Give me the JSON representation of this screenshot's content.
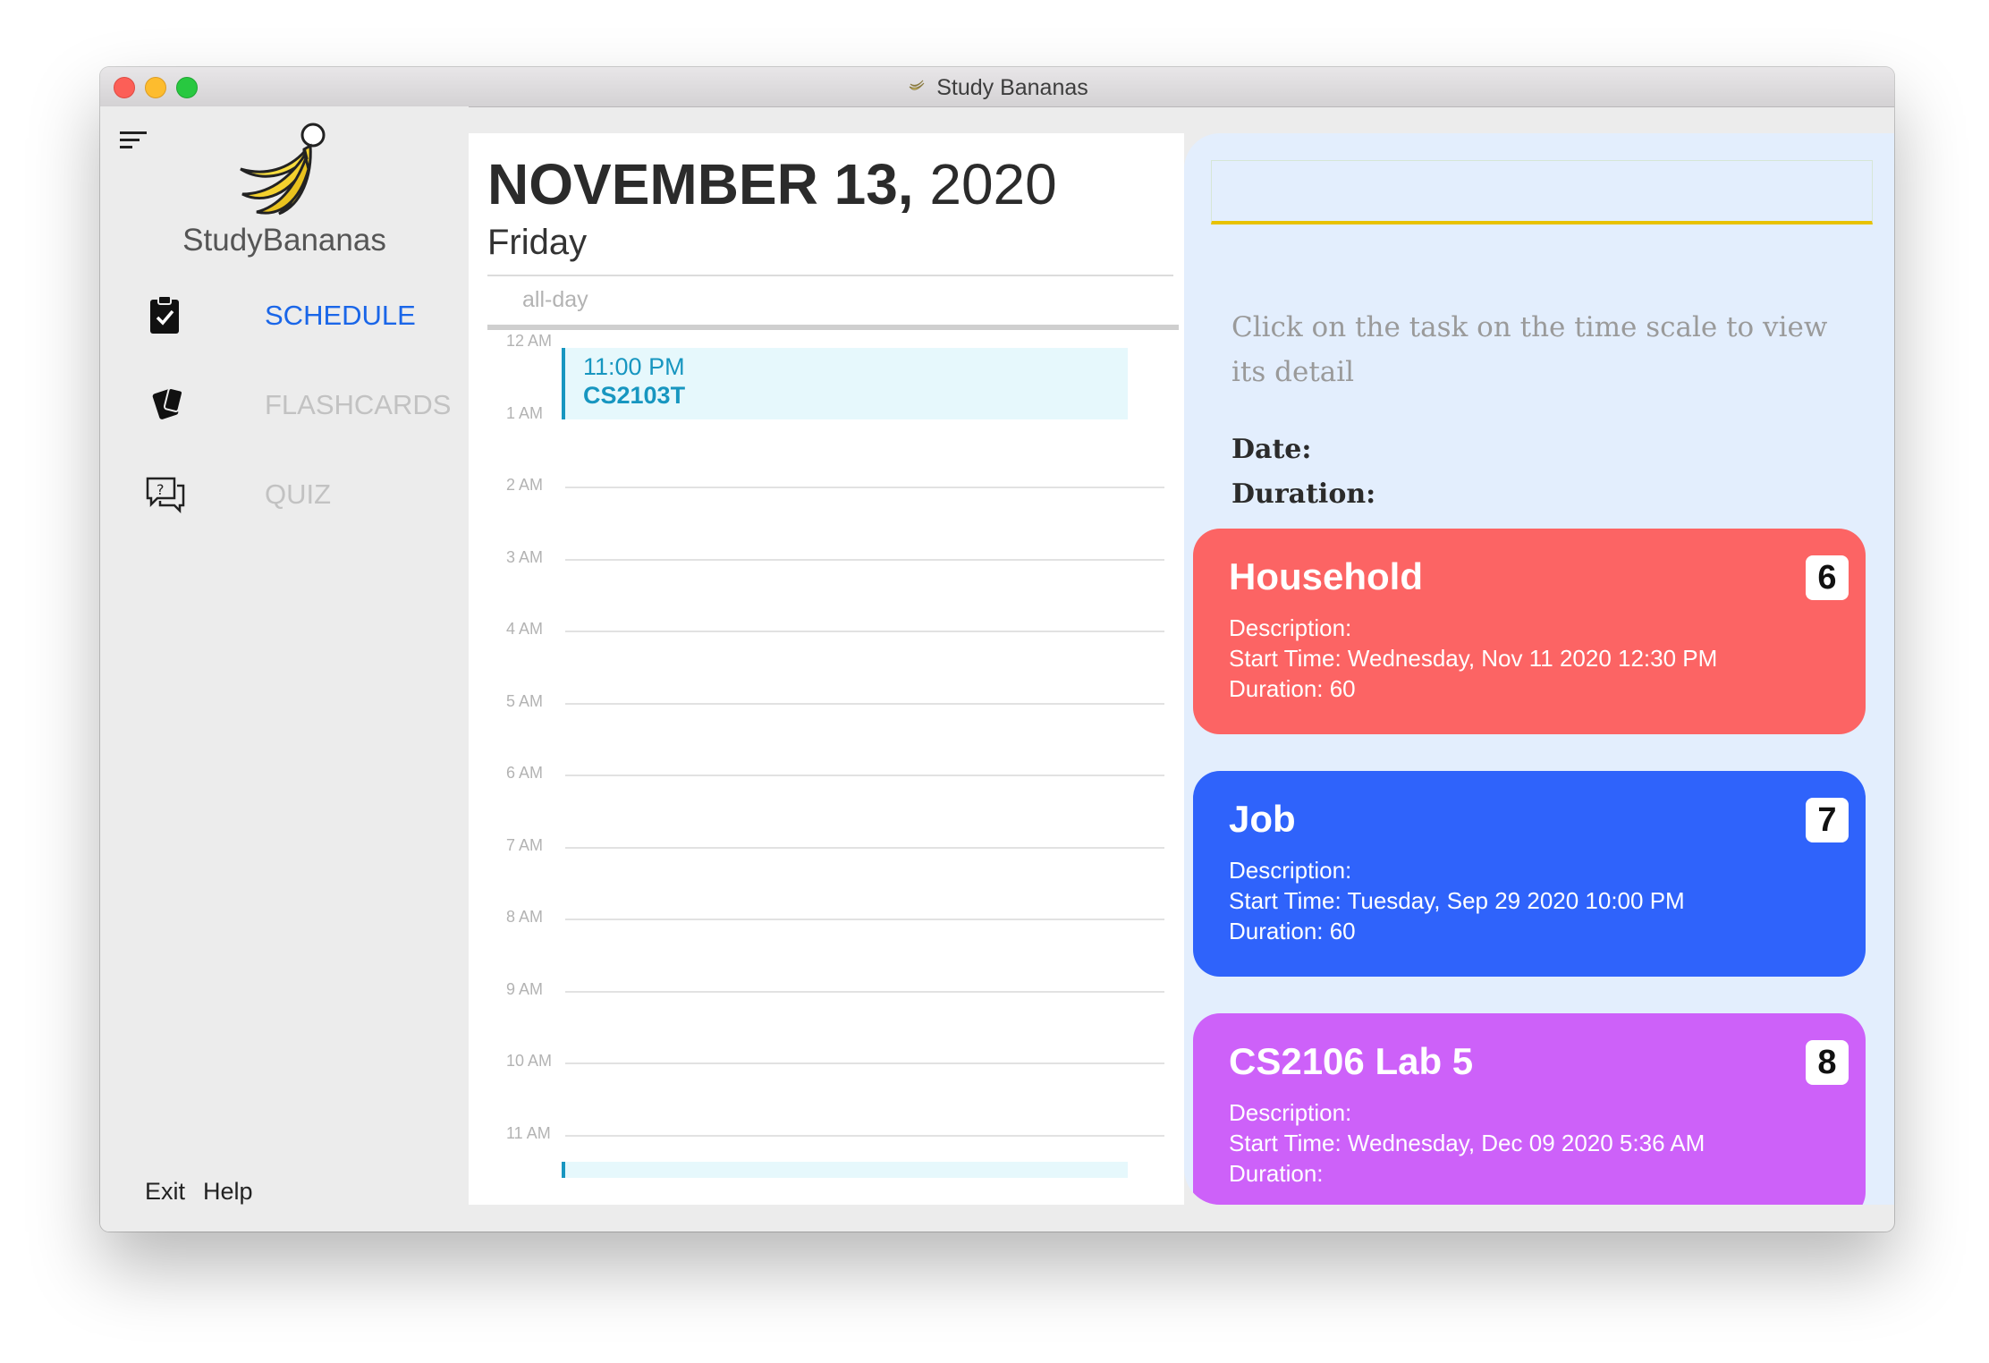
{
  "window": {
    "title": "Study Bananas"
  },
  "sidebar": {
    "brand": "StudyBananas",
    "nav": [
      {
        "label": "SCHEDULE",
        "icon": "clipboard-check-icon",
        "active": true
      },
      {
        "label": "FLASHCARDS",
        "icon": "cards-icon",
        "active": false
      },
      {
        "label": "QUIZ",
        "icon": "quiz-chat-icon",
        "active": false
      }
    ],
    "footer": {
      "exit": "Exit",
      "help": "Help"
    }
  },
  "calendar": {
    "date_bold": "NOVEMBER 13,",
    "year": "2020",
    "weekday": "Friday",
    "allday_label": "all-day",
    "hours": [
      "12 AM",
      "1 AM",
      "2 AM",
      "3 AM",
      "4 AM",
      "5 AM",
      "6 AM",
      "7 AM",
      "8 AM",
      "9 AM",
      "10 AM",
      "11 AM"
    ],
    "event": {
      "time": "11:00 PM",
      "name": "CS2103T"
    }
  },
  "detail": {
    "search_value": "",
    "hint": "Click on the task on the time scale to view its detail",
    "date_label": "Date:",
    "duration_label": "Duration:"
  },
  "tasks": [
    {
      "title": "Household",
      "index": "6",
      "description_label": "Description:",
      "start": "Start Time:  Wednesday, Nov 11 2020    12:30 PM",
      "duration": "Duration:  60",
      "color": "#fc6464"
    },
    {
      "title": "Job",
      "index": "7",
      "description_label": "Description:",
      "start": "Start Time:  Tuesday, Sep 29 2020    10:00 PM",
      "duration": "Duration:  60",
      "color": "#2f63fb"
    },
    {
      "title": "CS2106 Lab 5",
      "index": "8",
      "description_label": "Description:",
      "start": "Start Time:  Wednesday, Dec 09 2020    5:36 AM",
      "duration": "Duration:",
      "color": "#cd61f9"
    }
  ]
}
